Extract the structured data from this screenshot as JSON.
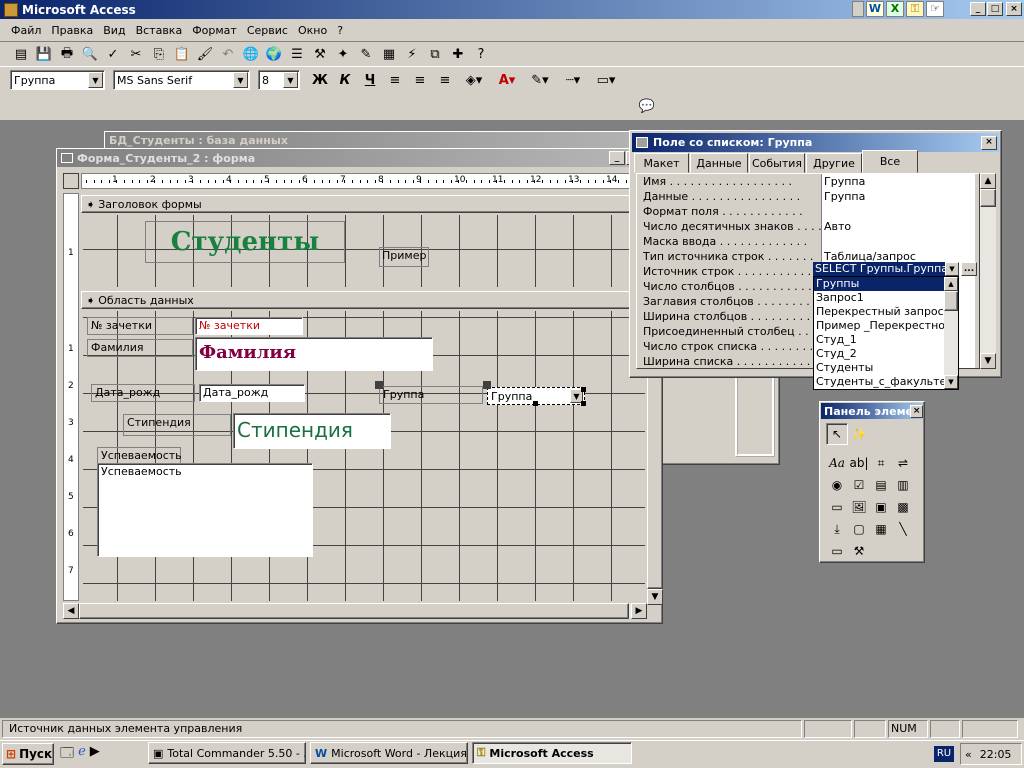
{
  "app": {
    "title": "Microsoft Access",
    "restore_btn": "_",
    "max_btn": "□",
    "close_btn": "×"
  },
  "menu": [
    "Файл",
    "Правка",
    "Вид",
    "Вставка",
    "Формат",
    "Сервис",
    "Окно",
    "?"
  ],
  "format_toolbar": {
    "object_combo": "Группа",
    "font_combo": "MS Sans Serif",
    "size_combo": "8",
    "bold": "Ж",
    "italic": "К",
    "underline": "Ч"
  },
  "db_window": {
    "title": "БД_Студенты : база данных"
  },
  "form_window": {
    "title": "Форма_Студенты_2 : форма",
    "ruler_numbers": [
      "1",
      "2",
      "3",
      "4",
      "5",
      "6",
      "7",
      "8",
      "9",
      "10",
      "11",
      "12",
      "13",
      "14"
    ],
    "vruler_numbers": [
      "1",
      "2",
      "3",
      "4",
      "5",
      "6",
      "7"
    ],
    "header_section": "Заголовок формы",
    "detail_section": "Область данных",
    "header_title": "Студенты",
    "header_example": "Пример",
    "controls": {
      "zachetka_label": "№ зачетки",
      "zachetka_field": "№ зачетки",
      "familia_label": "Фамилия",
      "familia_field": "Фамилия",
      "dob_label": "Дата_рожд",
      "dob_field": "Дата_рожд",
      "gruppa_label": "Группа",
      "gruppa_combo": "Группа",
      "stipend_label": "Стипендия",
      "stipend_field": "Стипендия",
      "uspev_label": "Успеваемость",
      "uspev_field": "Успеваемость"
    }
  },
  "props_window": {
    "title": "Поле со списком: Группа",
    "tabs": [
      "Макет",
      "Данные",
      "События",
      "Другие",
      "Все"
    ],
    "active_tab": "Все",
    "rows": [
      {
        "name": "Имя . . . . . . . . . . . . . . . . . .",
        "value": "Группа"
      },
      {
        "name": "Данные . . . . . . . . . . . . . . . .",
        "value": "Группа"
      },
      {
        "name": "Формат поля . . . . . . . . . . . .",
        "value": ""
      },
      {
        "name": "Число десятичных знаков . . . .",
        "value": "Авто"
      },
      {
        "name": "Маска ввода . . . . . . . . . . . . .",
        "value": ""
      },
      {
        "name": "Тип источника строк . . . . . . .",
        "value": "Таблица/запрос"
      },
      {
        "name": "Источник строк . . . . . . . . . . .",
        "value": "SELECT Группы.Группа FF"
      },
      {
        "name": "Число столбцов . . . . . . . . . . .",
        "value": ""
      },
      {
        "name": "Заглавия столбцов . . . . . . . . .",
        "value": ""
      },
      {
        "name": "Ширина столбцов . . . . . . . . . .",
        "value": ""
      },
      {
        "name": "Присоединенный столбец . . . .",
        "value": ""
      },
      {
        "name": "Число строк списка . . . . . . . .",
        "value": ""
      },
      {
        "name": "Ширина списка . . . . . . . . . . .",
        "value": ""
      }
    ],
    "build_btn": "...",
    "dropdown_items": [
      "Группы",
      "Запрос1",
      "Перекрестный запрос",
      "Пример _Перекрестного_",
      "Студ_1",
      "Студ_2",
      "Студенты",
      "Студенты_с_факультет"
    ],
    "selected_item": "Группы"
  },
  "toolbox": {
    "title": "Панель элемен",
    "close": "×"
  },
  "statusbar": {
    "text": "Источник данных элемента управления",
    "num": "NUM"
  },
  "taskbar": {
    "start": "Пуск",
    "tasks": [
      "Total Commander 5.50 - ...",
      "Microsoft Word - Лекция...",
      "Microsoft Access"
    ],
    "lang": "RU",
    "chevron": "«",
    "clock": "22:05"
  }
}
